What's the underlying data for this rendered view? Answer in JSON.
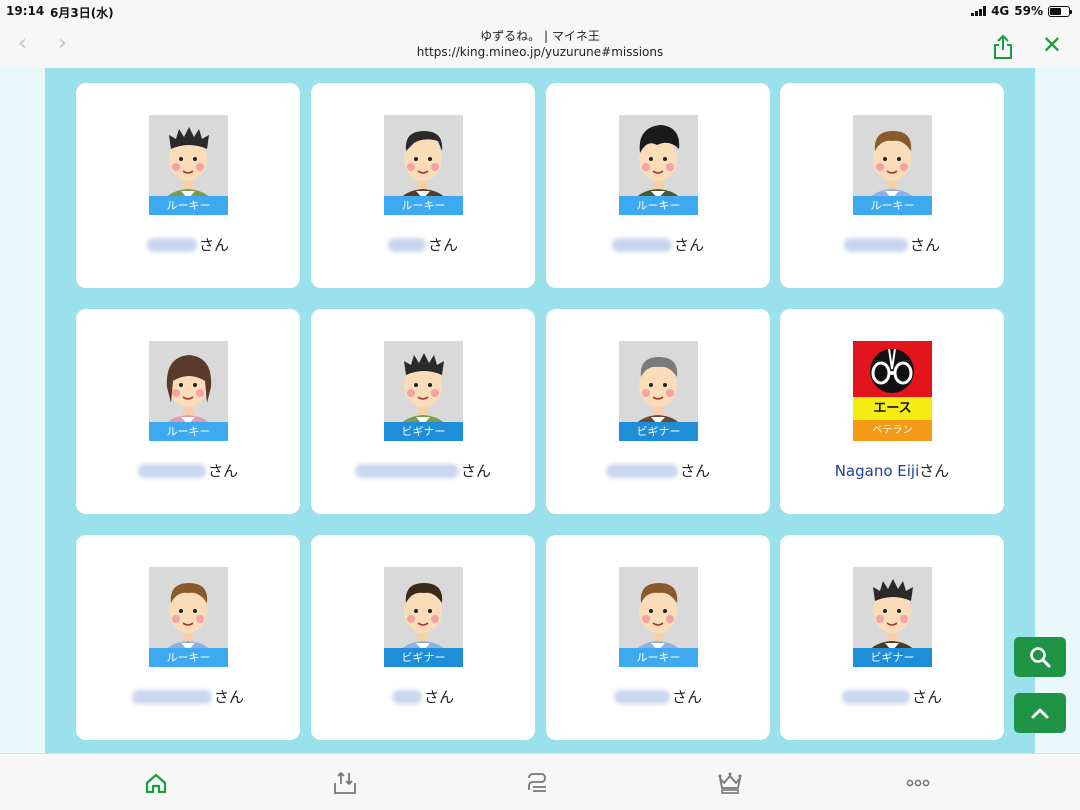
{
  "status_bar": {
    "time": "19:14",
    "date": "6月3日(水)",
    "network": "4G",
    "battery": "59%",
    "battery_level": 0.59
  },
  "browser": {
    "page_title": "ゆずるね。 | マイネ王",
    "url": "https://king.mineo.jp/yuzurune#missions",
    "back_icon": "‹",
    "forward_icon": "›",
    "close_icon": "✕"
  },
  "colors": {
    "accent_green": "#1a9d3e",
    "content_bg": "#9ae1ec",
    "rookie_badge": "#3da9f0",
    "beginner_badge": "#1f8ed8",
    "ace_red": "#e3141b",
    "ace_yellow": "#f5ec12",
    "ace_orange": "#f59a17"
  },
  "honorific": "さん",
  "users": [
    {
      "rank": "ルーキー",
      "rank_type": "rookie",
      "avatar": "man-spiky-green-shirt",
      "name": ""
    },
    {
      "rank": "ルーキー",
      "rank_type": "rookie",
      "avatar": "man-parted-brown-shirt",
      "name": ""
    },
    {
      "rank": "ルーキー",
      "rank_type": "rookie",
      "avatar": "man-black-hair-smiling",
      "name": ""
    },
    {
      "rank": "ルーキー",
      "rank_type": "rookie",
      "avatar": "man-brown-hair-blue-shirt",
      "name": ""
    },
    {
      "rank": "ルーキー",
      "rank_type": "rookie",
      "avatar": "woman-bob-hair",
      "name": ""
    },
    {
      "rank": "ビギナー",
      "rank_type": "beginner",
      "avatar": "man-spiky-green-shirt",
      "name": ""
    },
    {
      "rank": "ビギナー",
      "rank_type": "beginner",
      "avatar": "older-man-brown-shirt",
      "name": ""
    },
    {
      "rank": "ベテラン",
      "rank_type": "veteran",
      "avatar": "ace-badge",
      "ace_label": "エース",
      "name": "Nagano Eiji"
    },
    {
      "rank": "ルーキー",
      "rank_type": "rookie",
      "avatar": "man-brown-hair-blue-shirt",
      "name": ""
    },
    {
      "rank": "ビギナー",
      "rank_type": "beginner",
      "avatar": "man-dark-hair-blue-shirt",
      "name": ""
    },
    {
      "rank": "ルーキー",
      "rank_type": "rookie",
      "avatar": "man-brown-hair-blue-shirt",
      "name": ""
    },
    {
      "rank": "ビギナー",
      "rank_type": "beginner",
      "avatar": "man-dark-spiky-brown-shirt",
      "name": ""
    }
  ],
  "floating_buttons": [
    {
      "icon": "search-icon"
    },
    {
      "icon": "chevron-up-icon"
    }
  ],
  "tab_bar": [
    {
      "icon": "home-icon",
      "active": true
    },
    {
      "icon": "upload-tray-icon",
      "active": false
    },
    {
      "icon": "chat-bubble-icon",
      "active": false
    },
    {
      "icon": "crown-icon",
      "active": false
    },
    {
      "icon": "more-dots-icon",
      "active": false
    }
  ]
}
